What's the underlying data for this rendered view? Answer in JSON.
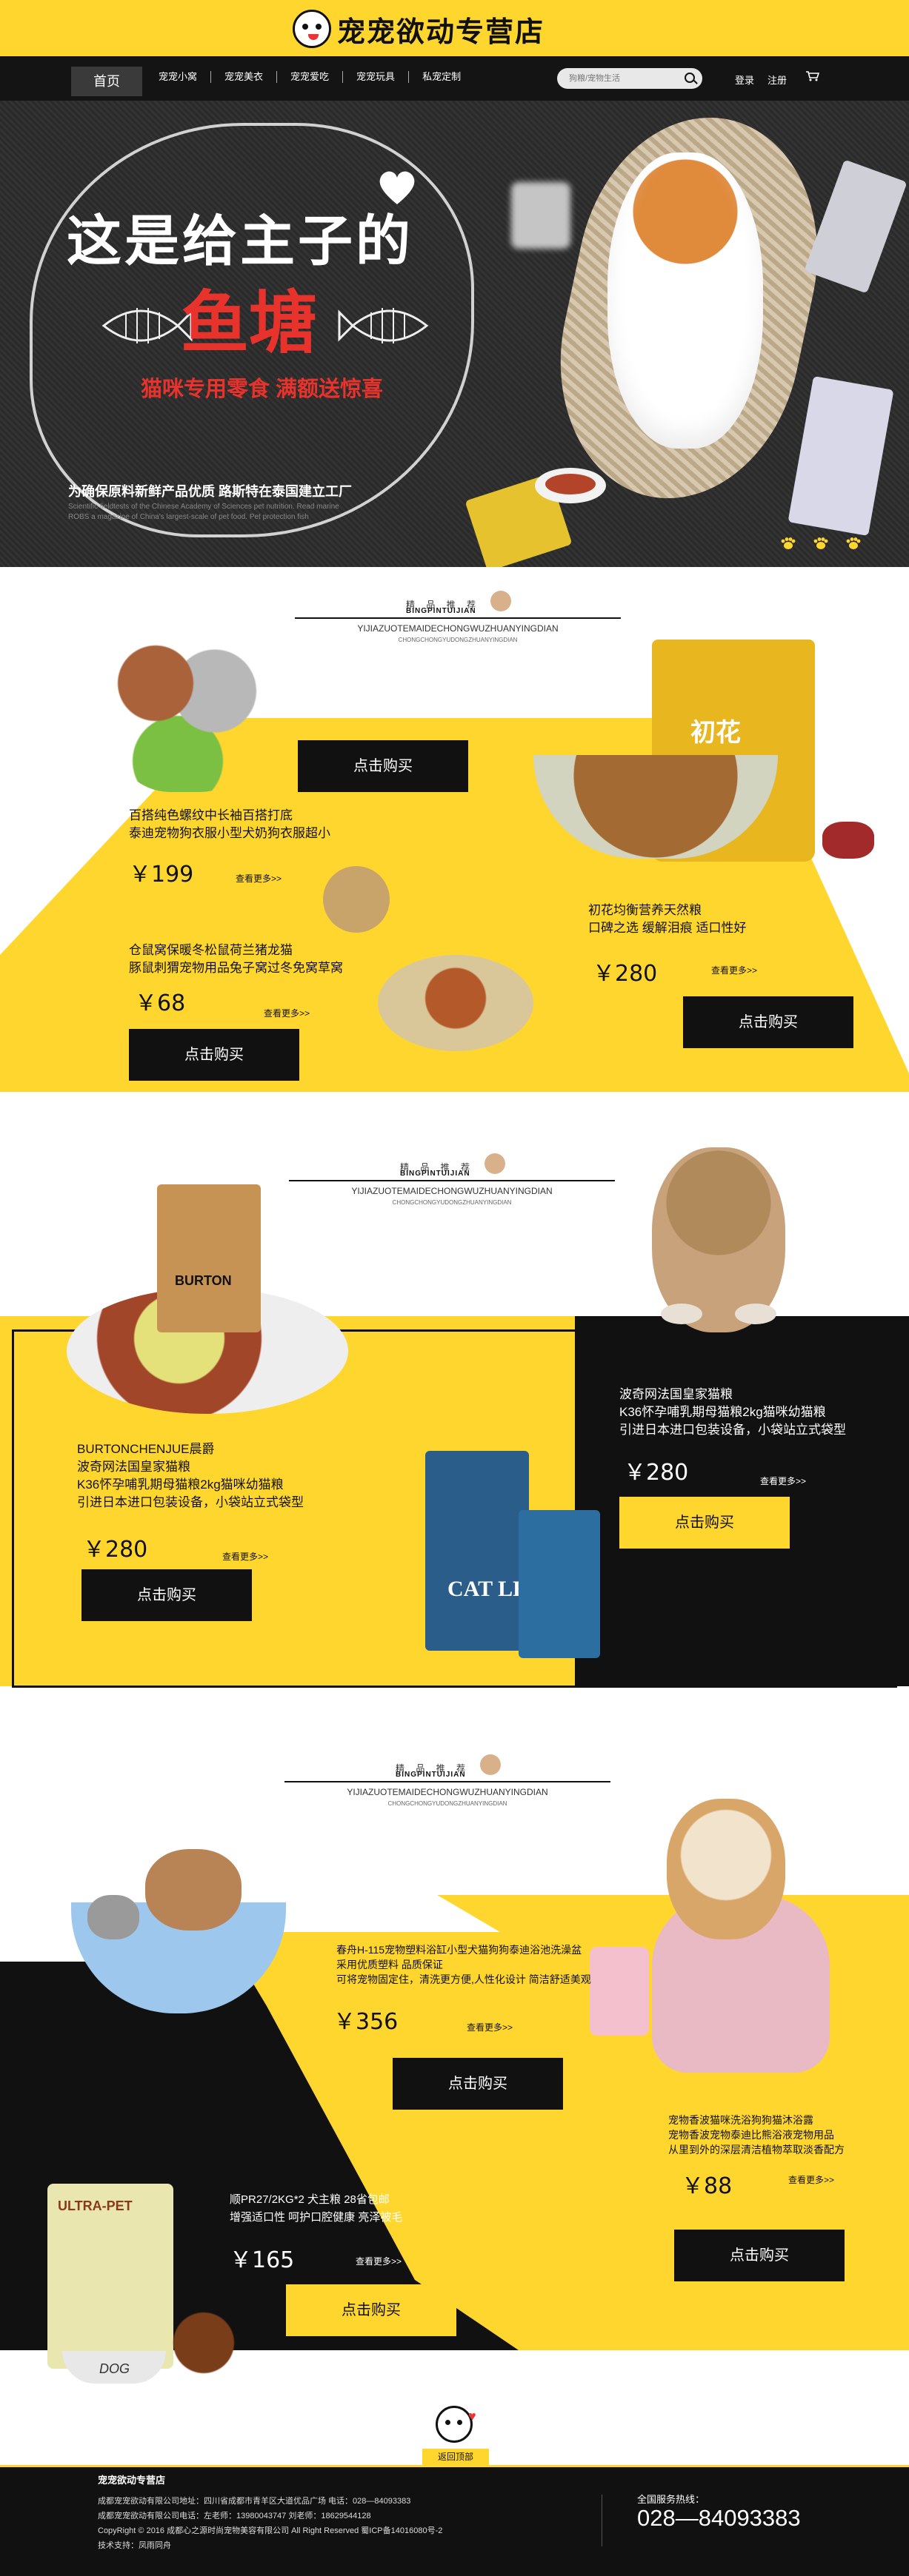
{
  "brand": {
    "name": "宠宠欲动专营店"
  },
  "nav": {
    "home": "首页",
    "items": [
      "宠宠小窝",
      "宠宠美衣",
      "宠宠爱吃",
      "宠宠玩具",
      "私宠定制"
    ],
    "search_placeholder": "狗粮/宠物生活",
    "login": "登录",
    "register": "注册"
  },
  "hero": {
    "title_line1": "这是给主子的",
    "title_line2": "鱼塘",
    "subtitle": "猫咪专用零食 满额送惊喜",
    "tagline": "为确保原料新鲜产品优质 路斯特在泰国建立工厂",
    "fine_print": "Scientific fieldtests of the Chinese Academy of Sciences pet nutrition. Read marine ROBS a magazine of China's largest-scale of pet food. Pet protection fish"
  },
  "section_header": {
    "pinyin_tag": "BINGPINTUIJIAN",
    "mini_logo": "精 品 推 荐",
    "en_line1": "YIJIAZUOTEMAIDECHONGWUZHUANYINGDIAN",
    "en_line2": "CHONGCHONGYUDONGZHUANYINGDIAN"
  },
  "section1": {
    "p1": {
      "line1": "百搭纯色螺纹中长袖百搭打底",
      "line2": "泰迪宠物狗衣服小型犬奶狗衣服超小",
      "price": "￥199",
      "more": "查看更多>>",
      "buy": "点击购买"
    },
    "p2": {
      "line1": "初花均衡营养天然粮",
      "line2": "口碑之选 缓解泪痕 适口性好",
      "price": "￥280",
      "more": "查看更多>>",
      "buy": "点击购买",
      "bag_label": "初花"
    },
    "p3": {
      "line1": "仓鼠窝保暖冬松鼠荷兰猪龙猫",
      "line2": "豚鼠刺猬宠物用品兔子窝过冬免窝草窝",
      "price": "￥68",
      "more": "查看更多>>",
      "buy": "点击购买"
    }
  },
  "section2": {
    "p1": {
      "line1": "BURTONCHENJUE晨爵",
      "line2": "波奇网法国皇家猫粮",
      "line3": "K36怀孕哺乳期母猫粮2kg猫咪幼猫粮",
      "line4": "引进日本进口包装设备，小袋站立式袋型",
      "price": "￥280",
      "more": "查看更多>>",
      "buy": "点击购买",
      "bag_label": "BURTON"
    },
    "p2": {
      "line1": "波奇网法国皇家猫粮",
      "line2": "K36怀孕哺乳期母猫粮2kg猫咪幼猫粮",
      "line3": "引进日本进口包装设备，小袋站立式袋型",
      "price": "￥280",
      "more": "查看更多>>",
      "buy": "点击购买",
      "pack_label": "CAT LEADER"
    }
  },
  "section3": {
    "p1": {
      "line1": "春舟H-115宠物塑料浴缸小型犬猫狗狗泰迪浴池洗澡盆",
      "line2": "采用优质塑料 品质保证",
      "line3": "可将宠物固定住，清洗更方便,人性化设计 简洁舒适美观",
      "price": "￥356",
      "more": "查看更多>>",
      "buy": "点击购买"
    },
    "p2": {
      "line1": "宠物香波猫咪洗浴狗狗猫沐浴露",
      "line2": "宠物香波宠物泰迪比熊浴液宠物用品",
      "line3": "从里到外的深层清洁植物萃取淡香配方",
      "price": "￥88",
      "more": "查看更多>>",
      "buy": "点击购买"
    },
    "p3": {
      "line1": "顺PR27/2KG*2 犬主粮 28省包邮",
      "line2": "增强适口性 呵护口腔健康 亮泽被毛",
      "price": "￥165",
      "more": "查看更多>>",
      "buy": "点击购买",
      "bag_label": "ULTRA-PET",
      "bowl_label": "DOG"
    }
  },
  "back_to_top": "返回顶部",
  "footer": {
    "title": "宠宠欲动专营店",
    "lines": [
      "成都宠宠欲动有限公司地址：四川省成都市青羊区大道优品广场 电话：028—84093383",
      "成都宠宠欲动有限公司电话：左老师：13980043747 刘老师：18629544128",
      "CopyRight © 2016 成都心之源时尚宠物美容有限公司 All Right Reserved 蜀ICP备14016080号-2",
      "技术支持：凤雨同舟"
    ],
    "hotline_label": "全国服务热线：",
    "hotline": "028—84093383"
  },
  "colors": {
    "accent": "#ffd62e",
    "dark": "#111111",
    "red": "#e8322c"
  }
}
